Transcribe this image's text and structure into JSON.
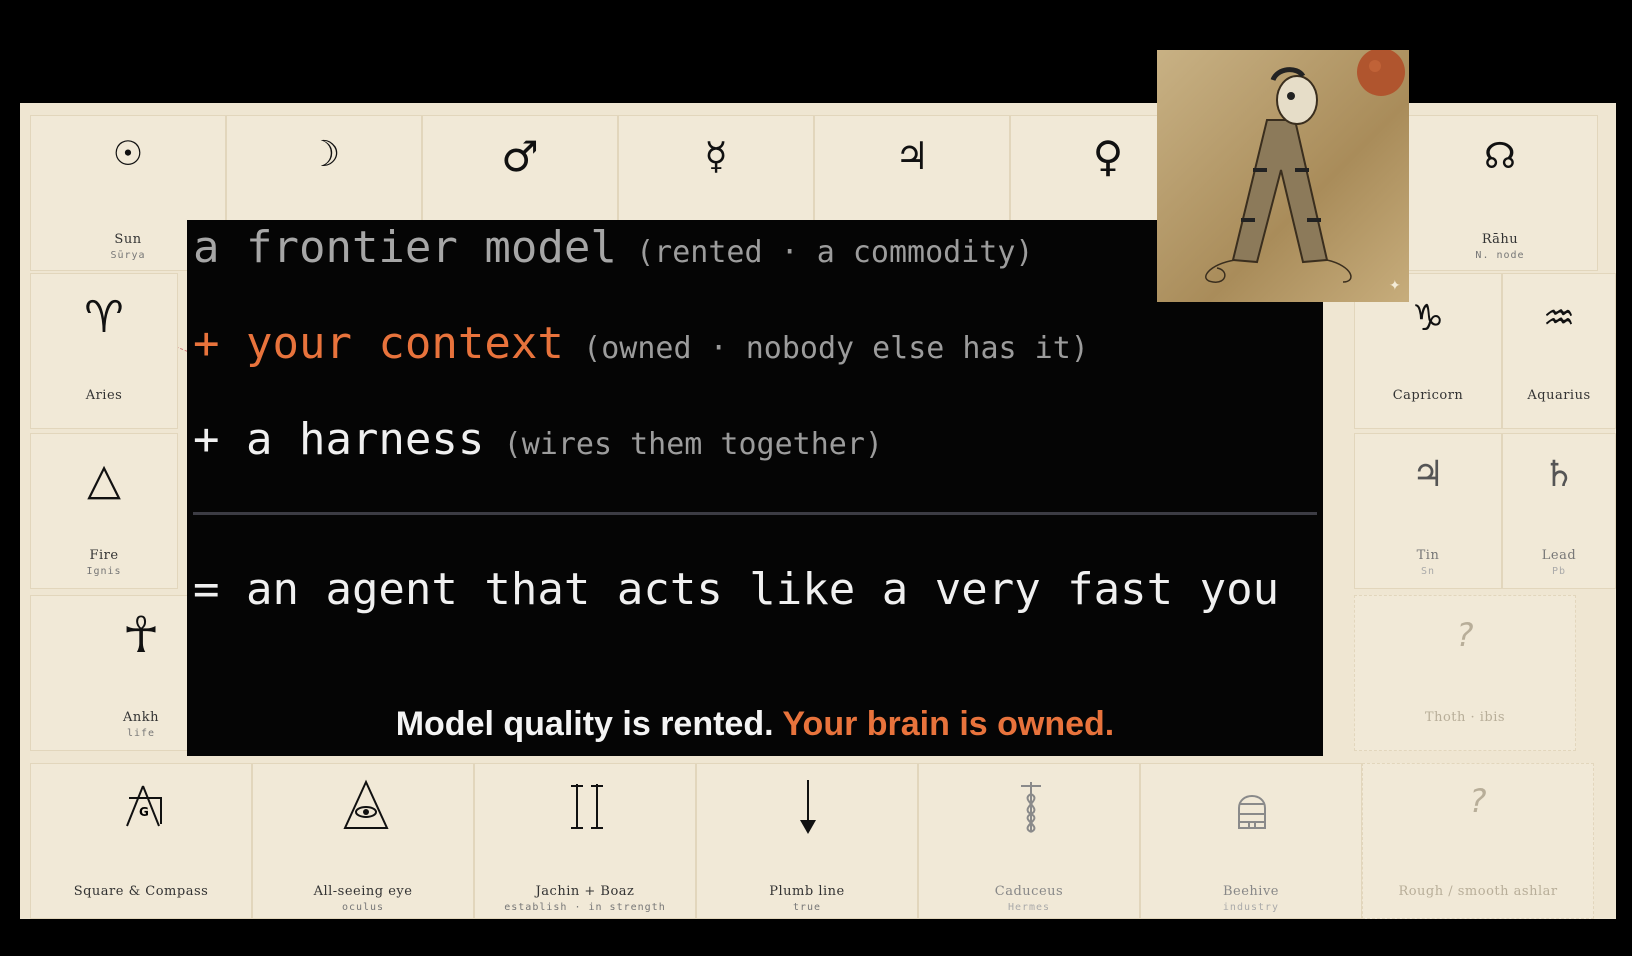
{
  "planets": [
    {
      "glyph": "☉",
      "name": "Sun",
      "sub": "Sūrya"
    },
    {
      "glyph": "☽",
      "name": "",
      "sub": ""
    },
    {
      "glyph": "♂",
      "name": "",
      "sub": ""
    },
    {
      "glyph": "☿",
      "name": "",
      "sub": ""
    },
    {
      "glyph": "♃",
      "name": "",
      "sub": ""
    },
    {
      "glyph": "♀",
      "name": "",
      "sub": ""
    },
    {
      "glyph": "☊",
      "name": "Rāhu",
      "sub": "N. node"
    }
  ],
  "signs_left": {
    "glyph": "♈",
    "name": "Aries"
  },
  "signs_right": [
    {
      "glyph": "♑",
      "name": "Capricorn"
    },
    {
      "glyph": "♒",
      "name": "Aquarius"
    }
  ],
  "elements_left": {
    "glyph": "△",
    "name": "Fire",
    "sub": "Ignis"
  },
  "metals_right": [
    {
      "glyph": "♃",
      "name": "Tin",
      "sub": "Sn"
    },
    {
      "glyph": "♄",
      "name": "Lead",
      "sub": "Pb"
    }
  ],
  "ankh": {
    "glyph": "☥",
    "name": "Ankh",
    "sub": "life"
  },
  "mystery_right": {
    "glyph": "?",
    "name": "Thoth · ibis"
  },
  "symbols": [
    {
      "name": "Square & Compass",
      "sub": ""
    },
    {
      "name": "All-seeing eye",
      "sub": "oculus"
    },
    {
      "name": "Jachin + Boaz",
      "sub": "establish · in strength"
    },
    {
      "name": "Plumb line",
      "sub": "true"
    },
    {
      "name": "Caduceus",
      "sub": "Hermes"
    },
    {
      "name": "Beehive",
      "sub": "industry"
    },
    {
      "glyph": "?",
      "name": "Rough / smooth ashlar",
      "sub": ""
    }
  ],
  "formula": {
    "line1_main": "a frontier model",
    "line1_note": "(rented · a commodity)",
    "line2_main": "+ your context",
    "line2_note": "(owned · nobody else has it)",
    "line3_main": "+ a harness",
    "line3_note": "(wires them together)",
    "result": "= an agent that acts like a very fast you"
  },
  "tagline": {
    "part1": "Model quality is rented.",
    "part2": "Your brain is owned."
  },
  "colors": {
    "accent": "#e8733c",
    "board": "#efe6d2",
    "panel": "#050505"
  }
}
